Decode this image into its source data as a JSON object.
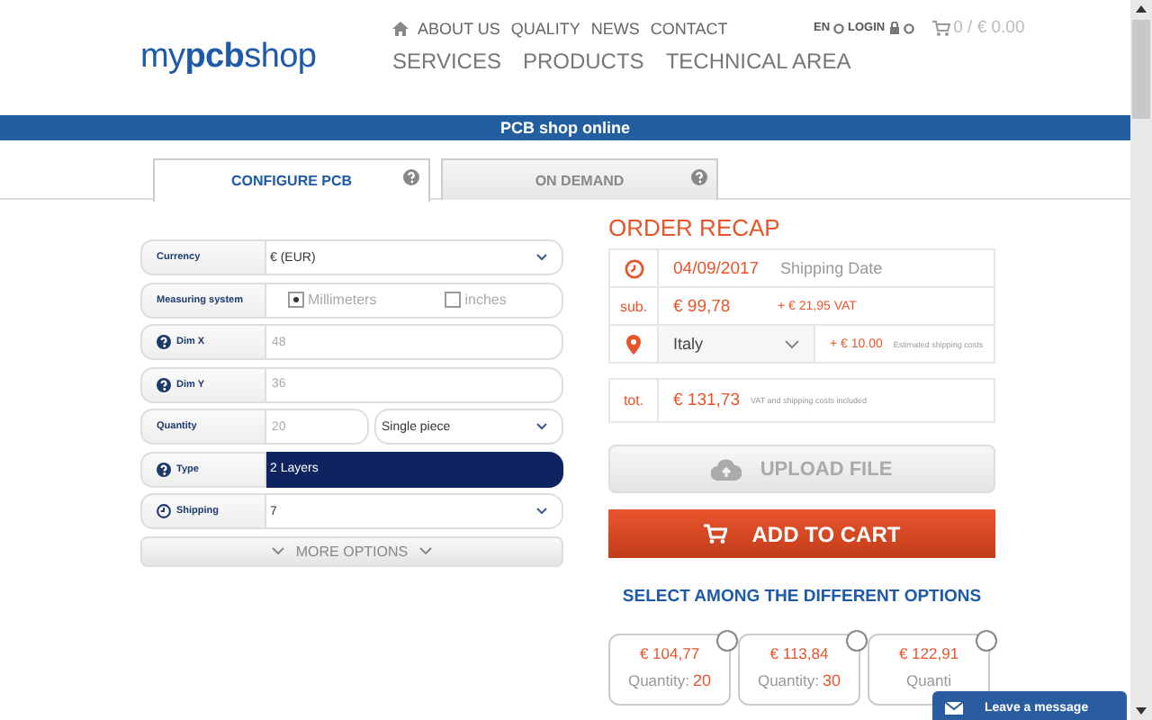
{
  "header": {
    "logo": {
      "prefix": "my",
      "bold": "pcb",
      "suffix": "shop"
    },
    "top_nav": [
      "ABOUT US",
      "QUALITY",
      "NEWS",
      "CONTACT"
    ],
    "main_nav": [
      "SERVICES",
      "PRODUCTS",
      "TECHNICAL AREA"
    ],
    "language": "EN",
    "login": "LOGIN",
    "cart": "0 / € 0.00"
  },
  "banner": "PCB shop online",
  "tabs": [
    {
      "label": "CONFIGURE PCB",
      "selected": true
    },
    {
      "label": "ON DEMAND",
      "selected": false
    }
  ],
  "form": [
    {
      "kind": "select",
      "label": "Currency",
      "value": "€ (EUR)"
    },
    {
      "kind": "radio",
      "label": "Measuring system",
      "options": [
        {
          "label": "Millimeters",
          "selected": true
        },
        {
          "label": "inches",
          "selected": false
        }
      ]
    },
    {
      "kind": "dimension",
      "label": "Dim X",
      "placeholder": "48"
    },
    {
      "kind": "dimension",
      "label": "Dim Y",
      "placeholder": "36"
    },
    {
      "kind": "quantity",
      "label": "Quantity",
      "placeholder": "20",
      "select": "Single piece"
    },
    {
      "kind": "type",
      "label": "Type",
      "value": "2 Layers"
    },
    {
      "kind": "shipping",
      "label": "Shipping",
      "value": "7"
    }
  ],
  "more_options": "MORE OPTIONS",
  "recap": {
    "title": "ORDER RECAP",
    "date": "04/09/2017",
    "date_label": "Shipping Date",
    "sub_label": "sub.",
    "subtotal": "€ 99,78",
    "vat": "+ € 21,95 VAT",
    "country": "Italy",
    "shipping": "+ € 10.00",
    "shipping_note": "Estimated shipping costs",
    "total_label": "tot.",
    "total": "€ 131,73",
    "total_note": "VAT and shipping costs included"
  },
  "upload_button": "UPLOAD FILE",
  "cart_button": "ADD TO CART",
  "options_title": "SELECT AMONG THE DIFFERENT OPTIONS",
  "options": [
    {
      "price": "€ 104,77",
      "quantity_label": "Quantity:",
      "quantity": "20",
      "selected": false
    },
    {
      "price": "€ 113,84",
      "quantity_label": "Quantity:",
      "quantity": "30",
      "selected": false
    },
    {
      "price": "€ 122,91",
      "quantity_label": "Quanti",
      "selected": false
    }
  ],
  "chat": "Leave a message"
}
